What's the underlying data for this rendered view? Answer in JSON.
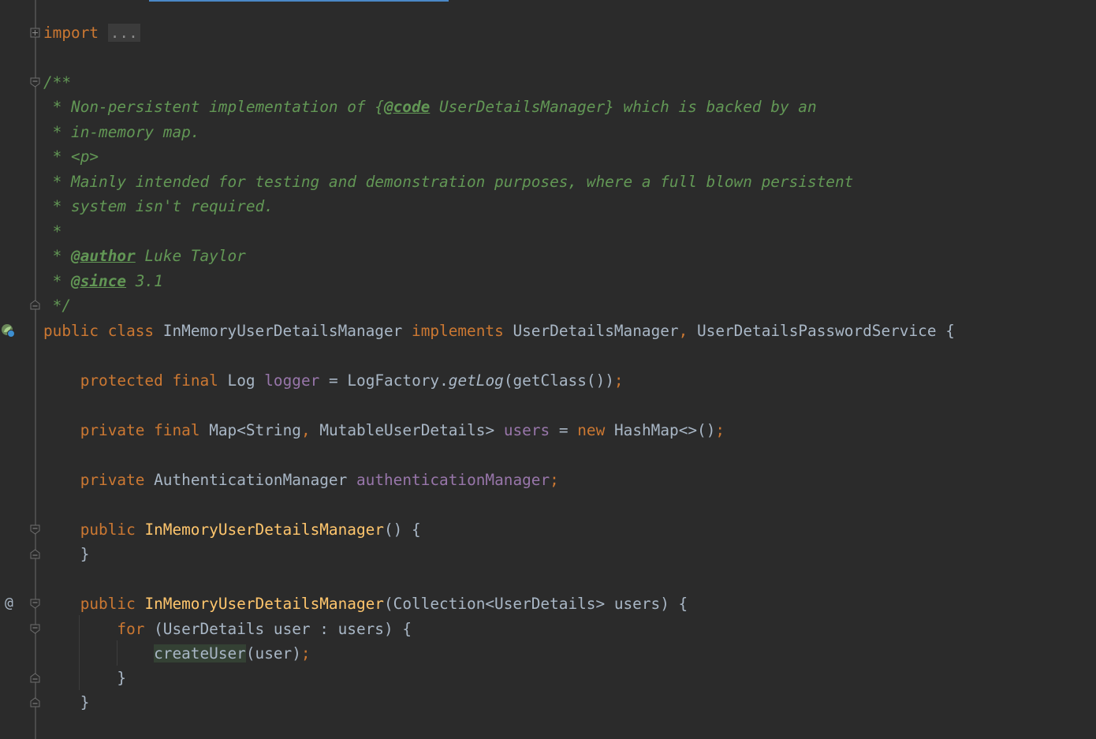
{
  "editor": {
    "icons": {
      "bean": "spring-bean-gutter-icon",
      "override": "at-sign-gutter-icon",
      "fold_expanded": "fold-expanded-icon",
      "fold_collapsed": "fold-collapsed-icon"
    },
    "colors": {
      "background": "#2b2b2b",
      "keyword": "#cc7832",
      "field": "#9876aa",
      "method": "#ffc66d",
      "doc": "#629755",
      "text": "#a9b7c6",
      "tab_indicator": "#4a88c7"
    },
    "lines": {
      "import_kw": "import",
      "import_folded": "...",
      "doc_open": "/**",
      "doc1_a": " * Non-persistent implementation of {",
      "doc1_tag": "@code",
      "doc1_b": " UserDetailsManager} which is backed by an",
      "doc2": " * in-memory map.",
      "doc3": " * <p>",
      "doc4": " * Mainly intended for testing and demonstration purposes, where a full blown persistent",
      "doc5": " * system isn't required.",
      "doc6": " *",
      "doc7_star": " * ",
      "doc7_tag": "@author",
      "doc7_rest": " Luke Taylor",
      "doc8_star": " * ",
      "doc8_tag": "@since",
      "doc8_rest": " 3.1",
      "doc_close": " */",
      "class_public": "public",
      "class_class": "class",
      "class_name": "InMemoryUserDetailsManager",
      "class_implements": "implements",
      "class_iface1": "UserDetailsManager",
      "class_comma": ",",
      "class_iface2": "UserDetailsPasswordService",
      "class_brace": "{",
      "f1_protected": "protected",
      "f1_final": "final",
      "f1_type": "Log",
      "f1_name": "logger",
      "f1_eq": "=",
      "f1_call_a": "LogFactory.",
      "f1_call_b": "getLog",
      "f1_call_c": "(getClass())",
      "f1_semi": ";",
      "f2_private": "private",
      "f2_final": "final",
      "f2_type": "Map<String",
      "f2_comma": ",",
      "f2_type2": "MutableUserDetails>",
      "f2_name": "users",
      "f2_eq": "=",
      "f2_new": "new",
      "f2_ctor": "HashMap<>()",
      "f2_semi": ";",
      "f3_private": "private",
      "f3_type": "AuthenticationManager",
      "f3_name": "authenticationManager",
      "f3_semi": ";",
      "c1_public": "public",
      "c1_name": "InMemoryUserDetailsManager",
      "c1_rest": "() {",
      "c1_close": "}",
      "c2_public": "public",
      "c2_name": "InMemoryUserDetailsManager",
      "c2_rest": "(Collection<UserDetails> users) {",
      "for_kw": "for",
      "for_rest": "(UserDetails user : users) {",
      "call_name": "createUser",
      "call_rest": "(user)",
      "call_semi": ";",
      "for_close": "}",
      "c2_close": "}"
    }
  }
}
